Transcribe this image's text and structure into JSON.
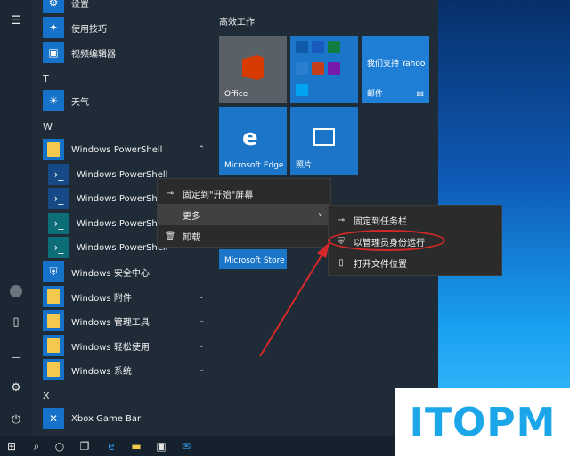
{
  "start_menu": {
    "apps": [
      {
        "id": "settings",
        "label": "设置",
        "icon": "gear-icon"
      },
      {
        "id": "tips",
        "label": "使用技巧",
        "icon": "lightbulb-icon"
      },
      {
        "id": "video-editor",
        "label": "视频编辑器",
        "icon": "video-editor-icon"
      },
      {
        "id": "weather",
        "label": "天气",
        "icon": "weather-icon"
      },
      {
        "id": "powershell-folder",
        "label": "Windows PowerShell",
        "icon": "folder-icon"
      },
      {
        "id": "ps1",
        "label": "Windows PowerShell",
        "icon": "powershell-icon"
      },
      {
        "id": "ps2",
        "label": "Windows PowerShell",
        "icon": "powershell-icon"
      },
      {
        "id": "ps3",
        "label": "Windows PowerShell",
        "icon": "powershell-ise-icon"
      },
      {
        "id": "ps4",
        "label": "Windows PowerShell",
        "icon": "powershell-ise-icon"
      },
      {
        "id": "security",
        "label": "Windows 安全中心",
        "icon": "shield-icon"
      },
      {
        "id": "accessories",
        "label": "Windows 附件",
        "icon": "folder-icon"
      },
      {
        "id": "admin-tools",
        "label": "Windows 管理工具",
        "icon": "folder-icon"
      },
      {
        "id": "ease",
        "label": "Windows 轻松使用",
        "icon": "folder-icon"
      },
      {
        "id": "system",
        "label": "Windows 系统",
        "icon": "folder-icon"
      },
      {
        "id": "xbox",
        "label": "Xbox Game Bar",
        "icon": "xbox-icon"
      }
    ],
    "letters": [
      "T",
      "W",
      "X"
    ]
  },
  "tiles": {
    "group_title": "高效工作",
    "office": "Office",
    "yahoo_text": "我们支持 Yahoo",
    "mail": "邮件",
    "edge": "Microsoft Edge",
    "photos": "照片",
    "store": "Microsoft Store"
  },
  "context_menu": {
    "pin_start": "固定到\"开始\"屏幕",
    "more": "更多",
    "uninstall": "卸载"
  },
  "submenu": {
    "pin_taskbar": "固定到任务栏",
    "run_admin": "以管理员身份运行",
    "open_location": "打开文件位置"
  },
  "watermark": "ITOPM",
  "colors": {
    "annotation": "#d62828",
    "tile_blue": "#1b75c9",
    "watermark": "#1aa6e8"
  }
}
